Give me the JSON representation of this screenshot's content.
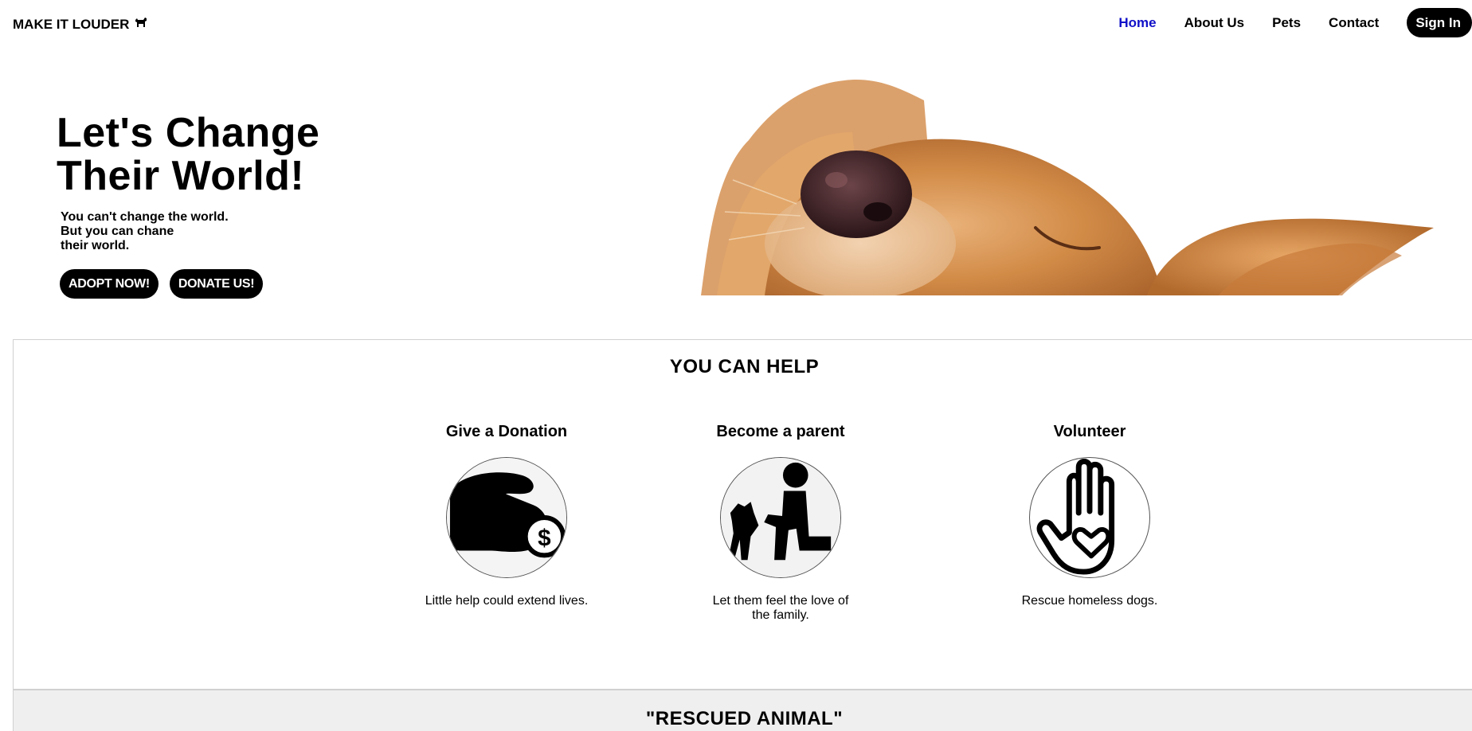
{
  "nav": {
    "brand": "MAKE IT LOUDER",
    "brand_icon": "dog-icon",
    "links": [
      "Home",
      "About Us",
      "Pets",
      "Contact"
    ],
    "active_link": "Home",
    "signin": "Sign In",
    "active_color": "#1010c8"
  },
  "hero": {
    "title_line1": "Let's Change",
    "title_line2": "Their World!",
    "sub_line1": "You can't change the world.",
    "sub_line2": "But you can chane",
    "sub_line3": "their world.",
    "adopt_button": "ADOPT NOW!",
    "donate_button": "DONATE US!",
    "image_icon": "puppy-photo"
  },
  "help": {
    "title": "YOU CAN HELP",
    "cards": [
      {
        "title": "Give a Donation",
        "text": "Little help could extend lives.",
        "icon": "donation-hand-icon"
      },
      {
        "title": "Become a parent",
        "text": "Let them feel the love of the family.",
        "icon": "person-with-dog-icon"
      },
      {
        "title": "Volunteer",
        "text": "Rescue homeless dogs.",
        "icon": "hand-heart-icon"
      }
    ]
  },
  "rescued": {
    "title": "\"RESCUED ANIMAL\""
  }
}
